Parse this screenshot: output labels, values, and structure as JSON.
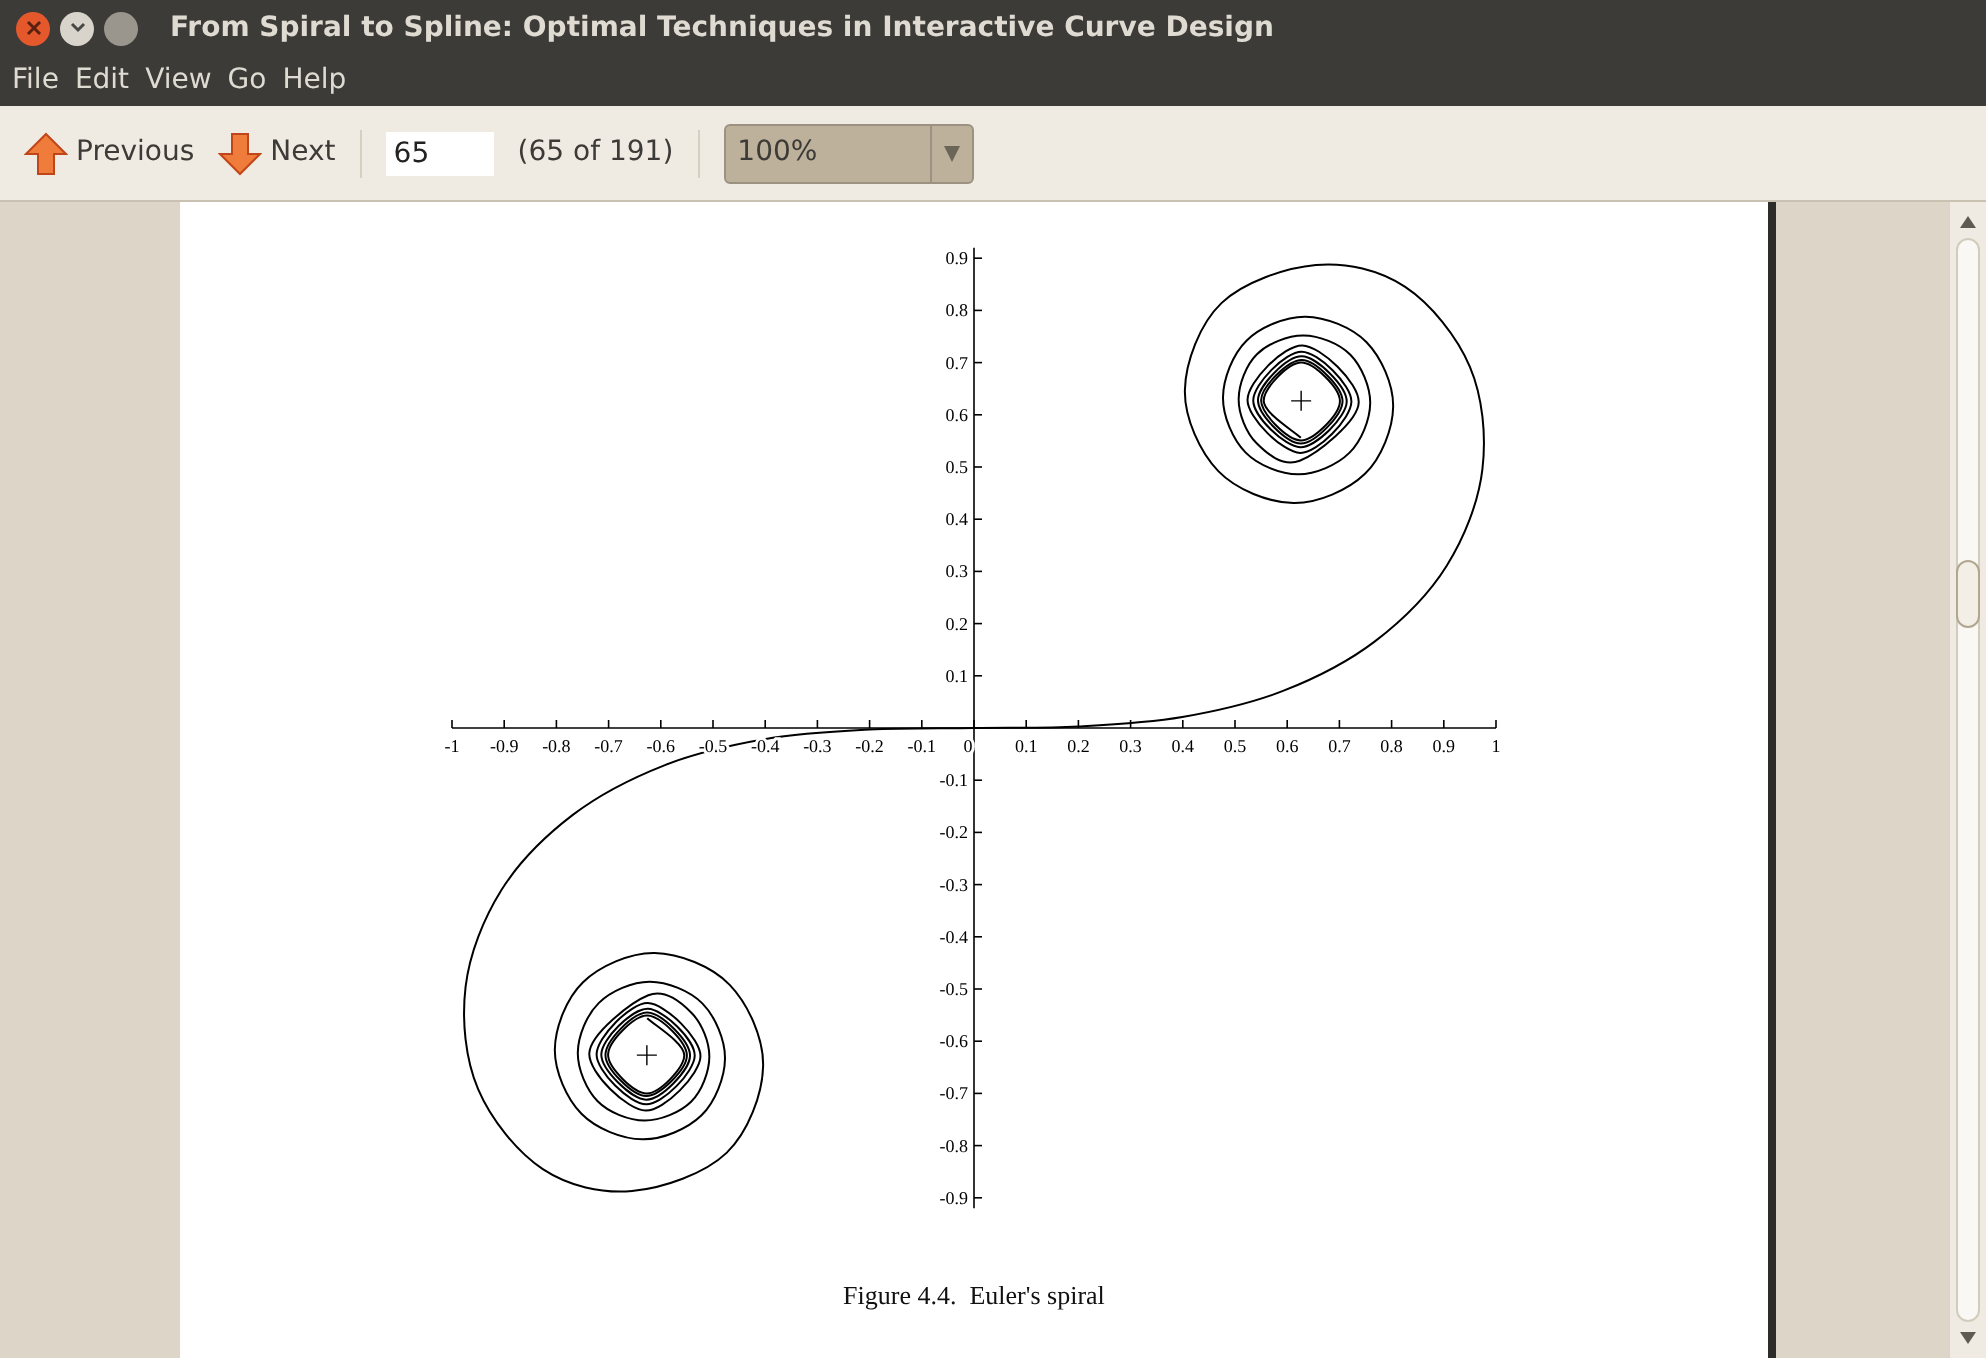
{
  "window": {
    "title": "From Spiral to Spline: Optimal Techniques in Interactive Curve Design"
  },
  "menu": [
    "File",
    "Edit",
    "View",
    "Go",
    "Help"
  ],
  "toolbar": {
    "previous": "Previous",
    "next": "Next",
    "page_field": "65",
    "page_count": "(65 of 191)",
    "zoom": "100%"
  },
  "figure": {
    "chart_data": {
      "type": "line",
      "xlim": [
        -1,
        1
      ],
      "ylim": [
        -0.92,
        0.92
      ],
      "xticks": [
        -1,
        -0.9,
        -0.8,
        -0.7,
        -0.6,
        -0.5,
        -0.4,
        -0.3,
        -0.2,
        -0.1,
        0,
        0.1,
        0.2,
        0.3,
        0.4,
        0.5,
        0.6,
        0.7,
        0.8,
        0.9,
        1
      ],
      "yticks": [
        0.9,
        0.8,
        0.7,
        0.6,
        0.5,
        0.4,
        0.3,
        0.2,
        0.1,
        -0.1,
        -0.2,
        -0.3,
        -0.4,
        -0.5,
        -0.6,
        -0.7,
        -0.8,
        -0.9
      ],
      "x": [
        -0.626,
        -0.555,
        -0.627,
        -0.701,
        -0.626,
        -0.55,
        -0.628,
        -0.706,
        -0.626,
        -0.544,
        -0.628,
        -0.714,
        -0.625,
        -0.535,
        -0.628,
        -0.723,
        -0.625,
        -0.524,
        -0.629,
        -0.737,
        -0.624,
        -0.541,
        -0.507,
        -0.542,
        -0.631,
        -0.721,
        -0.759,
        -0.719,
        -0.621,
        -0.52,
        -0.477,
        -0.522,
        -0.635,
        -0.752,
        -0.803,
        -0.749,
        -0.612,
        -0.468,
        -0.404,
        -0.474,
        -0.655,
        -0.826,
        -0.95,
        -0.974,
        -0.905,
        -0.768,
        -0.592,
        -0.399,
        -0.2,
        0,
        0.2,
        0.399,
        0.592,
        0.768,
        0.905,
        0.974,
        0.95,
        0.826,
        0.655,
        0.474,
        0.404,
        0.468,
        0.612,
        0.749,
        0.803,
        0.752,
        0.635,
        0.522,
        0.477,
        0.52,
        0.621,
        0.719,
        0.759,
        0.721,
        0.631,
        0.542,
        0.507,
        0.541,
        0.624,
        0.737,
        0.629,
        0.524,
        0.625,
        0.723,
        0.628,
        0.535,
        0.625,
        0.714,
        0.628,
        0.544,
        0.626,
        0.706,
        0.628,
        0.55,
        0.626,
        0.701,
        0.627,
        0.555,
        0.626
      ],
      "series": [
        {
          "color": "#000000",
          "values": [
            -0.556,
            -0.627,
            -0.7,
            -0.626,
            -0.551,
            -0.628,
            -0.705,
            -0.626,
            -0.545,
            -0.628,
            -0.712,
            -0.625,
            -0.538,
            -0.628,
            -0.721,
            -0.625,
            -0.527,
            -0.629,
            -0.733,
            -0.624,
            -0.512,
            -0.546,
            -0.63,
            -0.716,
            -0.752,
            -0.715,
            -0.622,
            -0.527,
            -0.486,
            -0.528,
            -0.633,
            -0.742,
            -0.788,
            -0.739,
            -0.616,
            -0.487,
            -0.431,
            -0.492,
            -0.647,
            -0.814,
            -0.887,
            -0.845,
            -0.692,
            -0.496,
            -0.31,
            -0.166,
            -0.071,
            -0.021,
            -0.003,
            0,
            0.003,
            0.021,
            0.071,
            0.166,
            0.31,
            0.496,
            0.692,
            0.845,
            0.887,
            0.814,
            0.647,
            0.492,
            0.431,
            0.487,
            0.616,
            0.739,
            0.788,
            0.742,
            0.633,
            0.528,
            0.486,
            0.527,
            0.622,
            0.715,
            0.752,
            0.716,
            0.63,
            0.546,
            0.512,
            0.624,
            0.733,
            0.629,
            0.527,
            0.625,
            0.721,
            0.628,
            0.538,
            0.625,
            0.712,
            0.628,
            0.545,
            0.626,
            0.705,
            0.628,
            0.551,
            0.626,
            0.7,
            0.627,
            0.556
          ]
        }
      ]
    },
    "caption": "Figure 4.4.  Euler's spiral"
  }
}
